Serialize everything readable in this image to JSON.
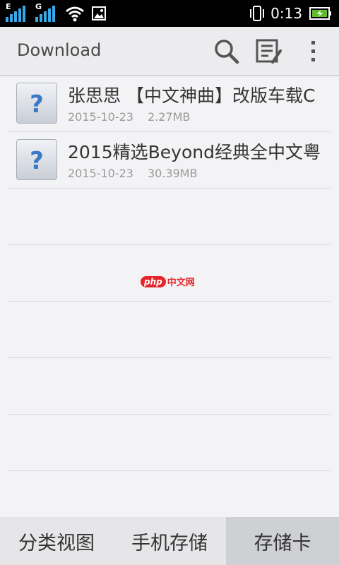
{
  "status_bar": {
    "network_1": "E",
    "network_2": "G",
    "time": "0:13"
  },
  "action_bar": {
    "title": "Download"
  },
  "files": [
    {
      "name": "张思思 【中文神曲】改版车载C",
      "date": "2015-10-23",
      "size": "2.27MB"
    },
    {
      "name": "2015精选Beyond经典全中文粤",
      "date": "2015-10-23",
      "size": "30.39MB"
    }
  ],
  "watermark": {
    "php": "php",
    "cn": "中文网"
  },
  "bottom_tabs": [
    {
      "label": "分类视图"
    },
    {
      "label": "手机存储"
    },
    {
      "label": "存储卡",
      "selected": true
    }
  ],
  "colors": {
    "accent": "#e5252a",
    "battery": "#5fbf2a"
  }
}
